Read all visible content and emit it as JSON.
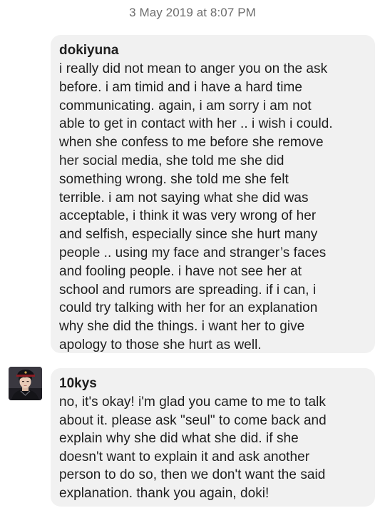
{
  "timestamp": "3 May 2019 at 8:07 PM",
  "messages": [
    {
      "sender": "dokiyuna",
      "text": "i really did not mean to anger you on the ask\nbefore. i am timid and i have a hard time\ncommunicating. again, i am sorry i am not\nable to get in contact with her .. i wish i could.\nwhen she confess to me before she remove\nher social media, she told me she did\nsomething wrong. she told me she felt\nterrible. i am not saying what she did was\nacceptable, i think it was very wrong of her\nand selfish, especially since she hurt many\npeople .. using my face and stranger’s faces\nand fooling people. i have not see her at\nschool and rumors are spreading. if i can, i\ncould try talking with her for an explanation\nwhy she did the things. i want her to give\napology to those she hurt as well."
    },
    {
      "sender": "10kys",
      "avatar_icon": "user-avatar",
      "text": "no, it's okay! i'm glad you came to me to talk\nabout it. please ask \"seul\" to come back and\nexplain why she did what she did. if she\ndoesn't want to explain it and ask another\nperson to do so, then we don't want the said\nexplanation. thank you again, doki!"
    }
  ]
}
